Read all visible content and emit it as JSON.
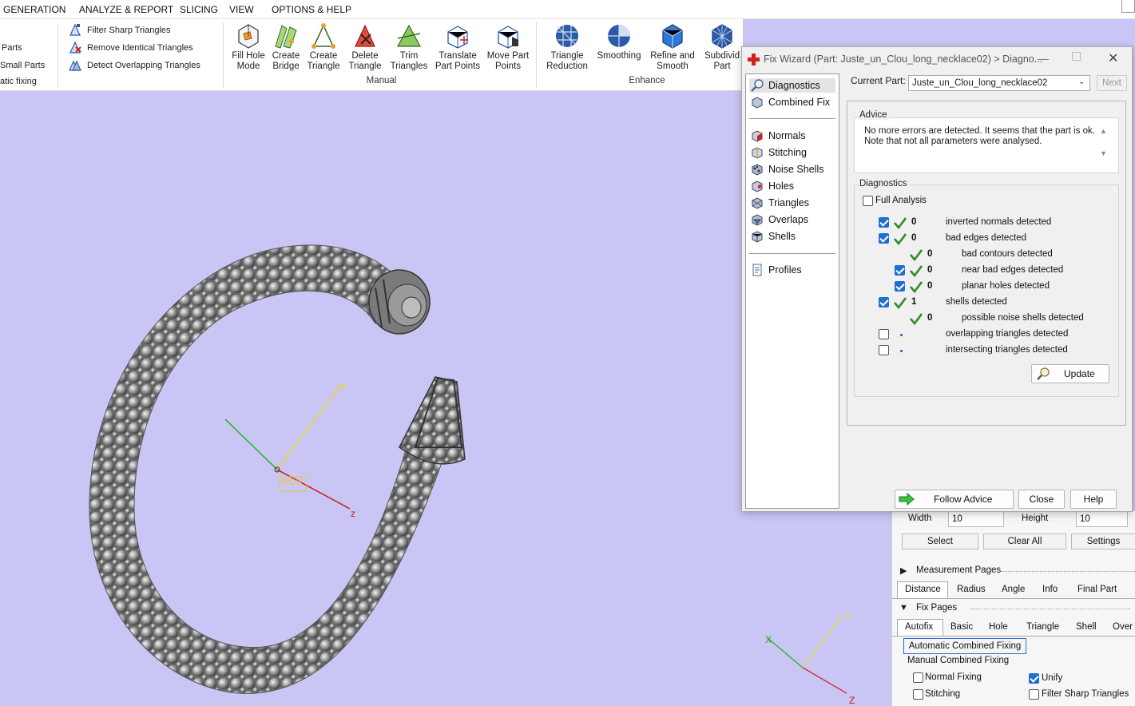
{
  "menu": {
    "items": [
      "GENERATION",
      "ANALYZE & REPORT",
      "SLICING",
      "VIEW",
      "OPTIONS & HELP"
    ]
  },
  "ribbon": {
    "left_partial": [
      "Parts",
      "Small Parts",
      "atic fixing"
    ],
    "filter_items": [
      "Filter Sharp Triangles",
      "Remove Identical Triangles",
      "Detect Overlapping Triangles"
    ],
    "manual_buttons": [
      [
        "Fill Hole",
        "Mode"
      ],
      [
        "Create",
        "Bridge"
      ],
      [
        "Create",
        "Triangle"
      ],
      [
        "Delete",
        "Triangle"
      ],
      [
        "Trim",
        "Triangles"
      ],
      [
        "Translate",
        "Part Points"
      ],
      [
        "Move Part",
        "Points"
      ]
    ],
    "enhance_buttons": [
      [
        "Triangle",
        "Reduction"
      ],
      [
        "Smoothing",
        ""
      ],
      [
        "Refine and",
        "Smooth"
      ],
      [
        "Subdivid",
        "Part"
      ]
    ],
    "group_manual": "Manual",
    "group_enhance": "Enhance"
  },
  "viewport": {
    "wcs_label": "WCS",
    "axis_y": "y",
    "axis_z": "z",
    "mini_axis_y": "Y",
    "mini_axis_x": "X",
    "mini_axis_z": "Z"
  },
  "dialog": {
    "title": "Fix Wizard (Part: Juste_un_Clou_long_necklace02) > Diagno...",
    "nav": {
      "top": [
        "Diagnostics",
        "Combined Fix"
      ],
      "middle": [
        "Normals",
        "Stitching",
        "Noise Shells",
        "Holes",
        "Triangles",
        "Overlaps",
        "Shells"
      ],
      "bottom": [
        "Profiles"
      ]
    },
    "current_part_label": "Current Part:",
    "current_part_value": "Juste_un_Clou_long_necklace02",
    "next_label": "Next",
    "advice_title": "Advice",
    "advice_line1": "No more errors are detected. It seems that the part is ok.",
    "advice_line2": "Note that not all parameters were analysed.",
    "diagnostics_title": "Diagnostics",
    "full_analysis": "Full Analysis",
    "rows": [
      {
        "checkbox": "checked",
        "value": "0",
        "label": "inverted normals detected",
        "indent": 0
      },
      {
        "checkbox": "checked",
        "value": "0",
        "label": "bad edges detected",
        "indent": 0
      },
      {
        "checkbox": "none",
        "value": "0",
        "label": "bad contours detected",
        "indent": 1
      },
      {
        "checkbox": "checked",
        "value": "0",
        "label": "near bad edges detected",
        "indent": 1
      },
      {
        "checkbox": "checked",
        "value": "0",
        "label": "planar holes detected",
        "indent": 1
      },
      {
        "checkbox": "checked",
        "value": "1",
        "label": "shells detected",
        "indent": 0
      },
      {
        "checkbox": "none",
        "value": "0",
        "label": "possible noise shells detected",
        "indent": 1
      },
      {
        "checkbox": "unchecked",
        "value": "",
        "label": "overlapping triangles detected",
        "indent": 0
      },
      {
        "checkbox": "unchecked",
        "value": "",
        "label": "intersecting triangles detected",
        "indent": 0
      }
    ],
    "update_label": "Update",
    "follow_advice_label": "Follow Advice",
    "close_label": "Close",
    "help_label": "Help"
  },
  "panel": {
    "width_label": "Width",
    "width_value": "10",
    "height_label": "Height",
    "height_value": "10",
    "select_label": "Select",
    "clear_all_label": "Clear All",
    "settings_label": "Settings",
    "measurement_pages": "Measurement Pages",
    "measure_tabs": [
      "Distance",
      "Radius",
      "Angle",
      "Info",
      "Final Part"
    ],
    "fix_pages": "Fix Pages",
    "fix_tabs": [
      "Autofix",
      "Basic",
      "Hole",
      "Triangle",
      "Shell",
      "Over"
    ],
    "auto_combined": "Automatic Combined Fixing",
    "manual_combined": "Manual Combined Fixing",
    "normal_fixing": "Normal Fixing",
    "unify": "Unify",
    "stitching": "Stitching",
    "filter_sharp": "Filter Sharp Triangles"
  },
  "colors": {
    "viewport_bg": "#c9c6f5",
    "check_green": "#2e8b2e",
    "checkbox_blue": "#1f6fd0"
  }
}
